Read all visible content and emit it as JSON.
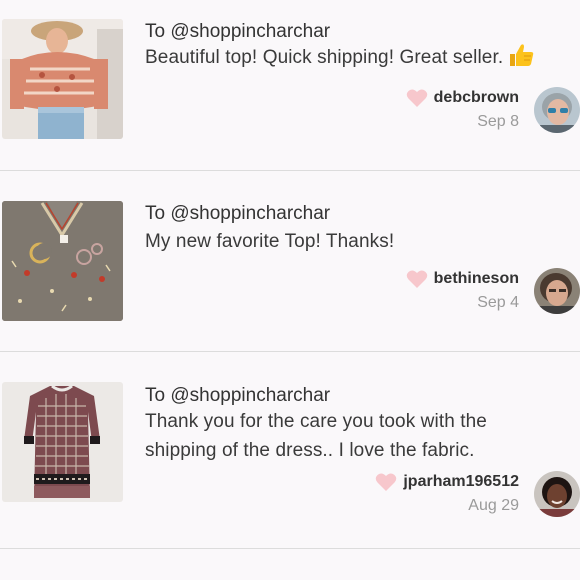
{
  "reviews": [
    {
      "to": "To @shoppincharchar",
      "message": "Beautiful top! Quick shipping! Great seller.",
      "emoji": "thumbs-up",
      "username": "debcbrown",
      "date": "Sep 8"
    },
    {
      "to": "To @shoppincharchar",
      "message": "My new favorite Top! Thanks!",
      "username": "bethineson",
      "date": "Sep 4"
    },
    {
      "to": "To @shoppincharchar",
      "message": "Thank you for the care you took with the shipping of the dress.. I love the fabric.",
      "username": "jparham196512",
      "date": "Aug 29"
    }
  ],
  "icons": {
    "heart": "heart-icon",
    "thumbs_up": "thumbs-up-icon"
  },
  "colors": {
    "heart": "#f7c7cc",
    "divider": "#dcdcdc",
    "date": "#9a9a9a",
    "background": "#faf8fa"
  }
}
